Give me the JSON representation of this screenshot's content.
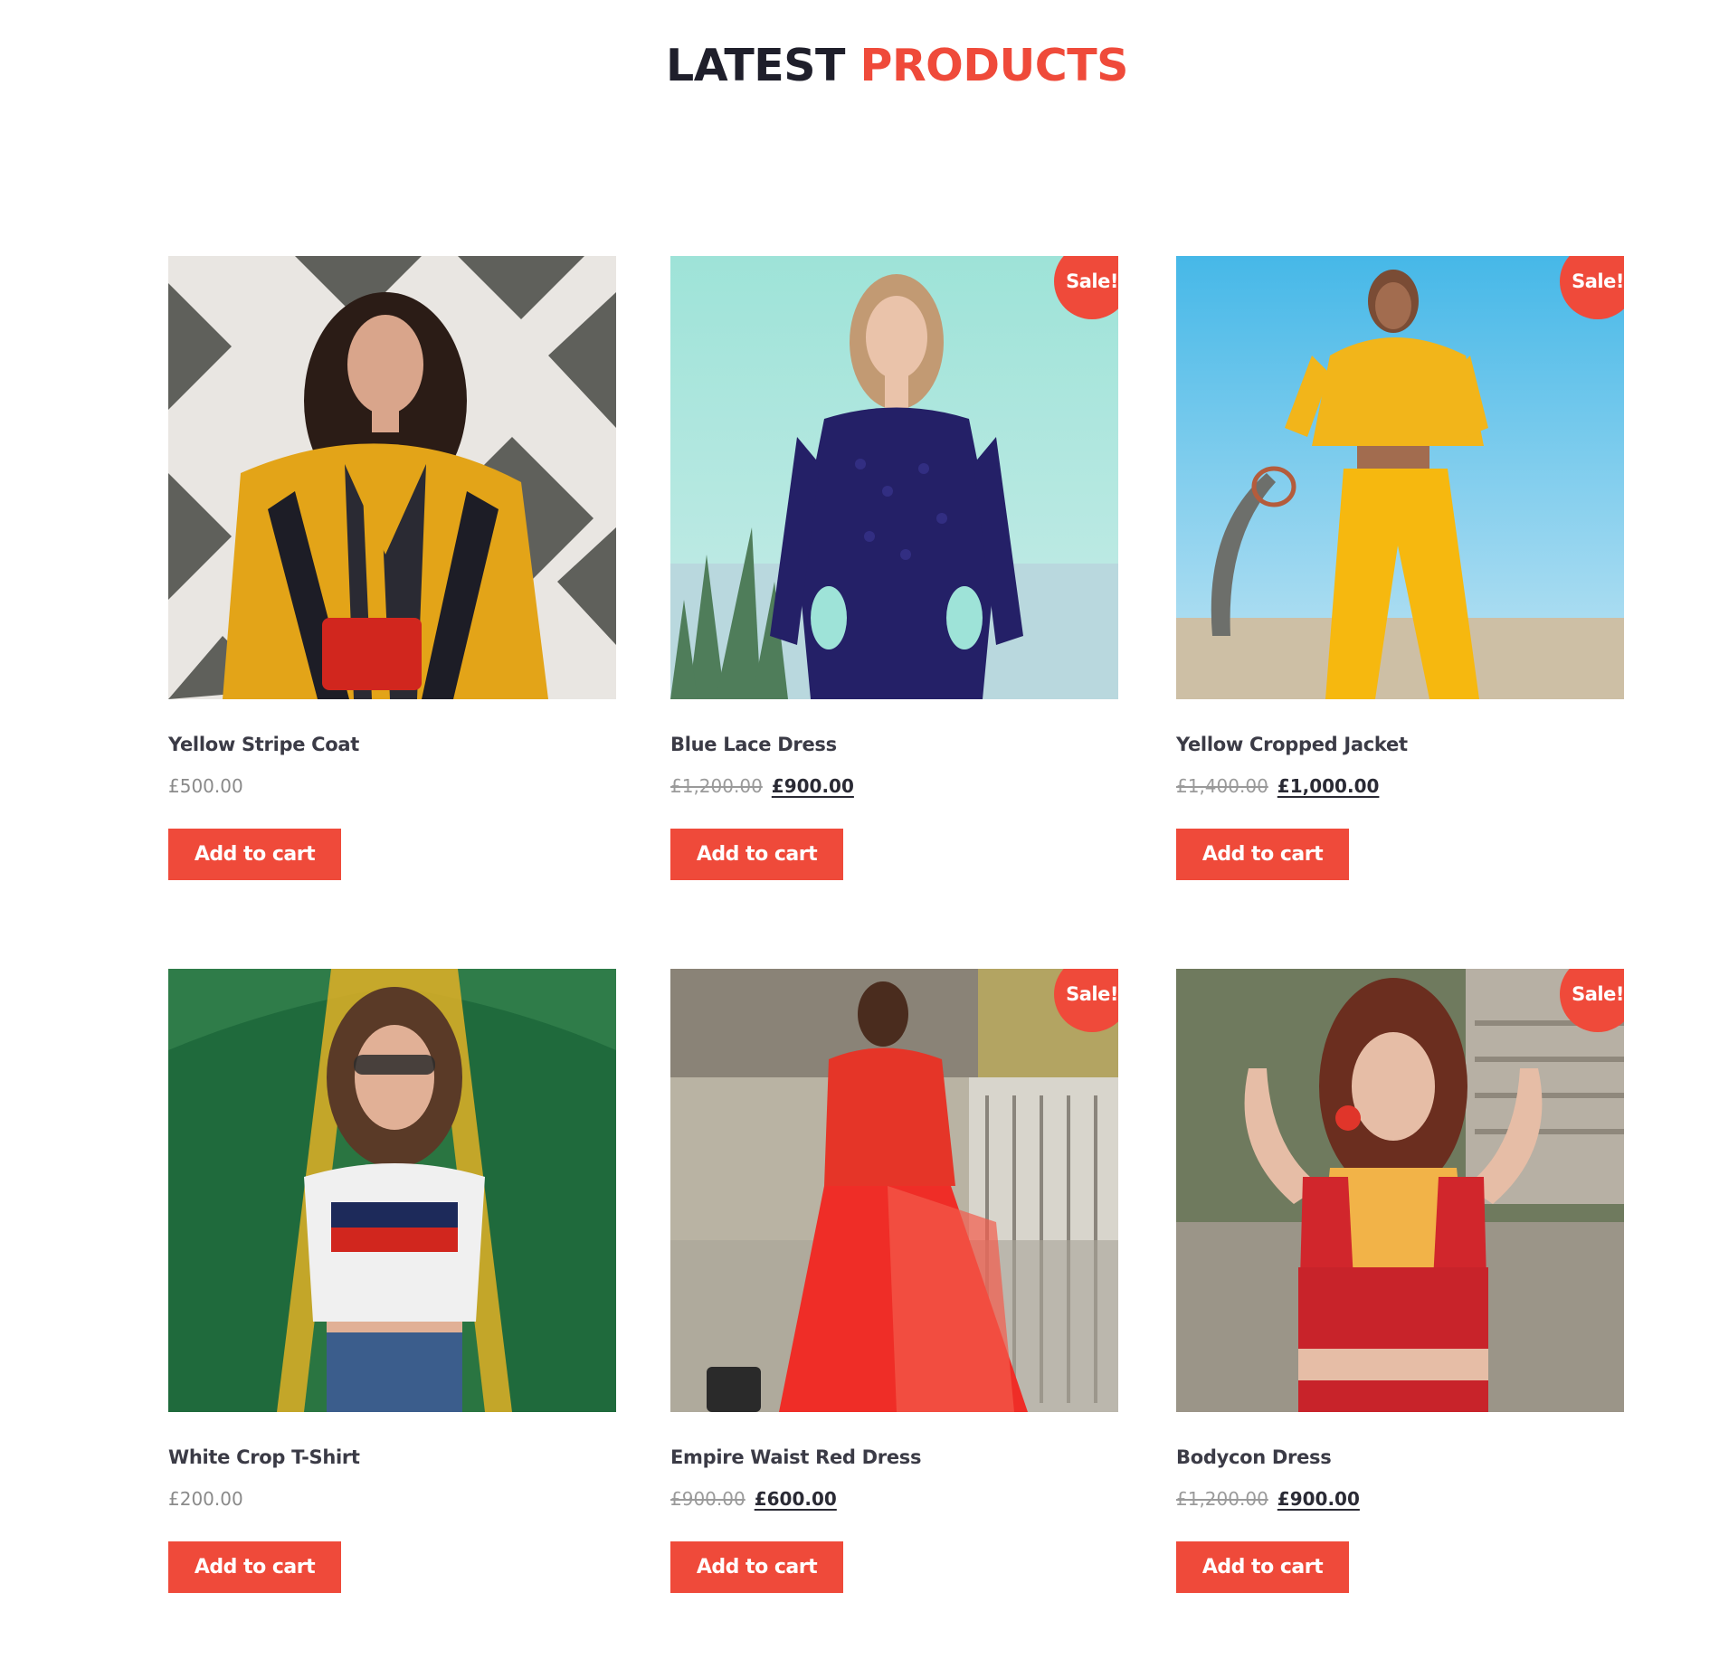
{
  "section": {
    "title_part1": "LATEST",
    "title_part2": "PRODUCTS",
    "accent_color": "#ef4a3a"
  },
  "products": [
    {
      "name": "Yellow Stripe Coat",
      "price": "£500.00",
      "old_price": "",
      "sale_badge": "",
      "cart_label": "Add to cart"
    },
    {
      "name": "Blue Lace Dress",
      "price": "£900.00",
      "old_price": "£1,200.00",
      "sale_badge": "Sale!",
      "cart_label": "Add to cart"
    },
    {
      "name": "Yellow Cropped Jacket",
      "price": "£1,000.00",
      "old_price": "£1,400.00",
      "sale_badge": "Sale!",
      "cart_label": "Add to cart"
    },
    {
      "name": "White Crop T-Shirt",
      "price": "£200.00",
      "old_price": "",
      "sale_badge": "",
      "cart_label": "Add to cart"
    },
    {
      "name": "Empire Waist Red Dress",
      "price": "£600.00",
      "old_price": "£900.00",
      "sale_badge": "Sale!",
      "cart_label": "Add to cart"
    },
    {
      "name": "Bodycon Dress",
      "price": "£900.00",
      "old_price": "£1,200.00",
      "sale_badge": "Sale!",
      "cart_label": "Add to cart"
    }
  ]
}
